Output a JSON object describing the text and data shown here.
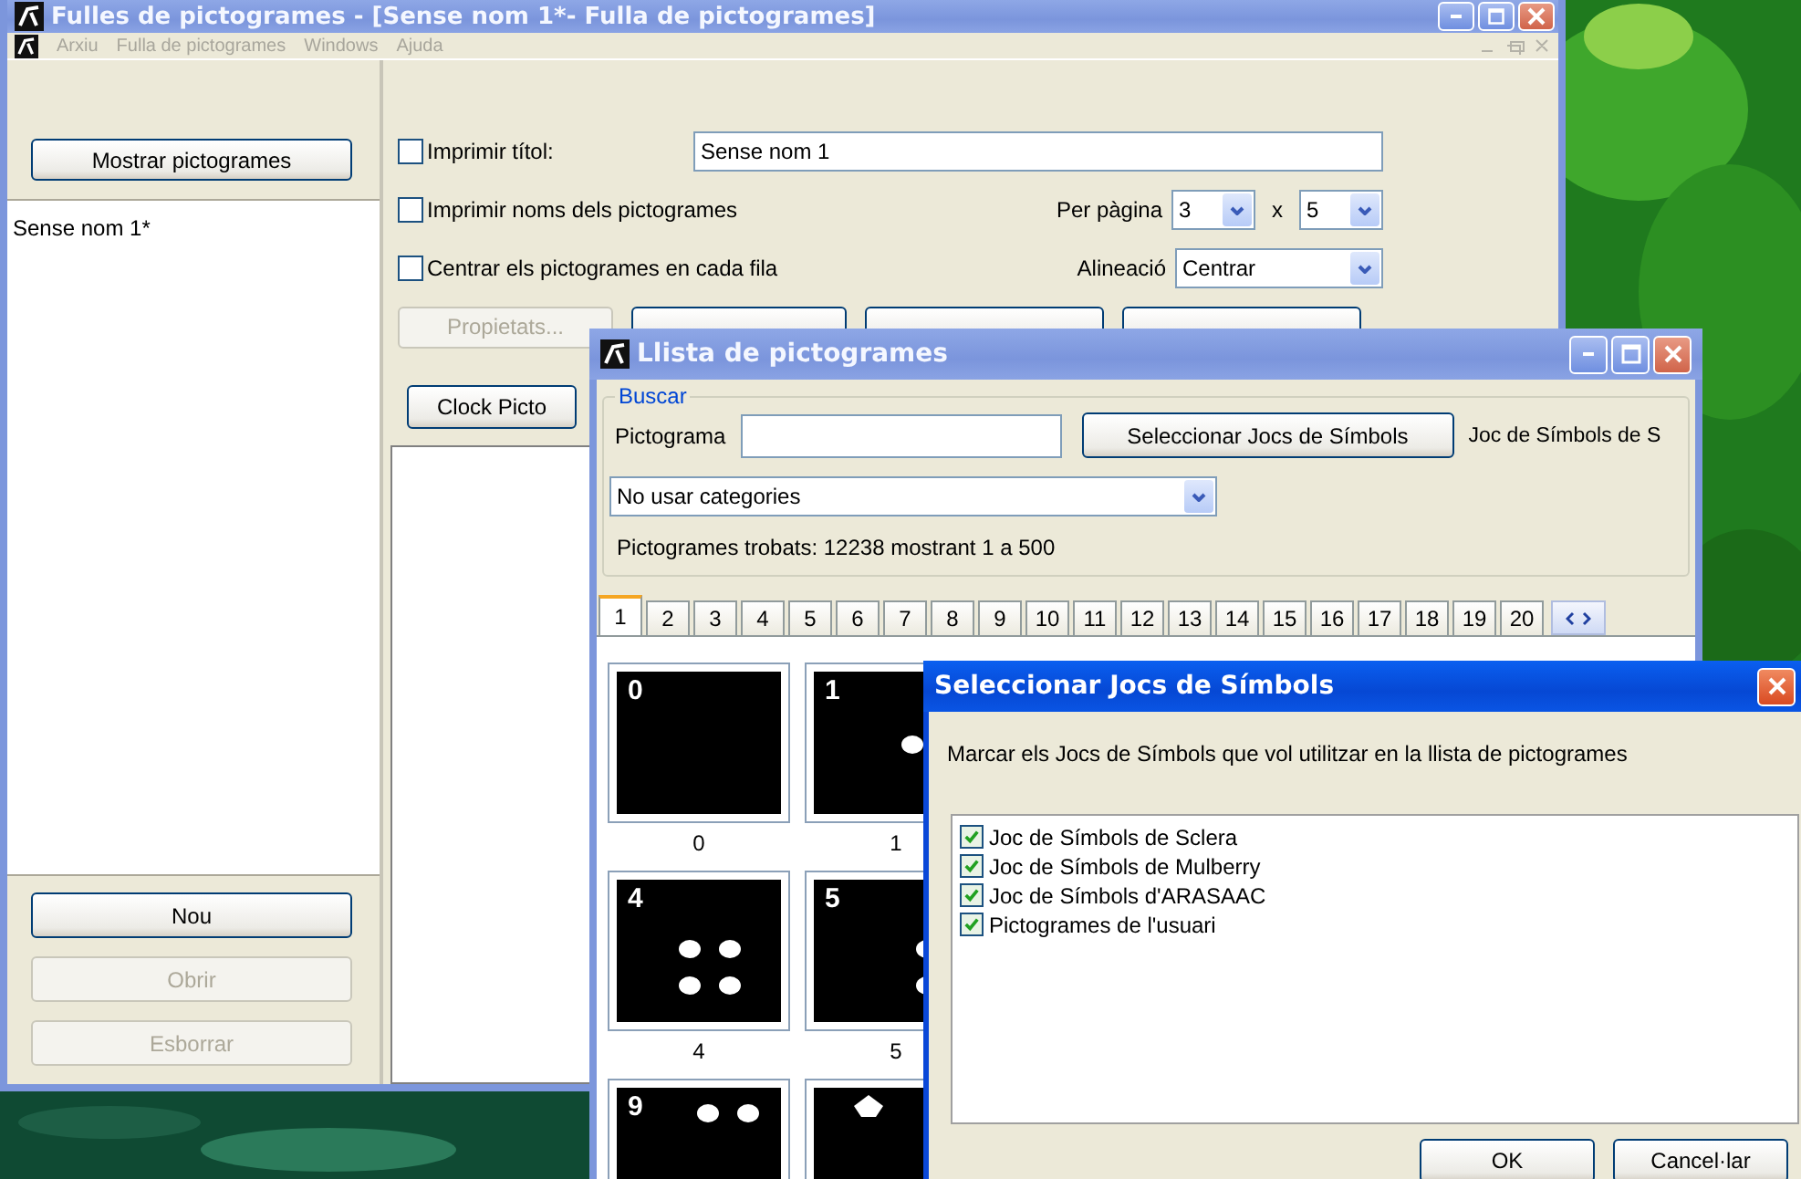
{
  "main_window": {
    "title": "Fulles de pictogrames - [Sense nom 1*- Fulla de pictogrames]",
    "menu": [
      {
        "label": "Arxiu",
        "disabled": true
      },
      {
        "label": "Fulla de pictogrames",
        "disabled": true
      },
      {
        "label": "Windows",
        "disabled": true
      },
      {
        "label": "Ajuda",
        "disabled": true
      }
    ],
    "show_button": "Mostrar pictogrames",
    "sheets": [
      {
        "label": "Sense nom 1*",
        "selected": false
      }
    ],
    "sheet_buttons": [
      {
        "label": "Nou",
        "disabled": false
      },
      {
        "label": "Obrir",
        "disabled": true
      },
      {
        "label": "Esborrar",
        "disabled": true
      }
    ],
    "print_title": {
      "label": "Imprimir títol:",
      "checked": false
    },
    "title_value": "Sense nom 1",
    "print_names": {
      "label": "Imprimir noms dels pictogrames",
      "checked": false
    },
    "center_rows": {
      "label": "Centrar els pictogrames en cada fila",
      "checked": false
    },
    "per_page_label": "Per pàgina",
    "rows_value": "3",
    "times": "x",
    "cols_value": "5",
    "alignment_label": "Alineació",
    "alignment_value": "Centrar",
    "properties_button": {
      "label": "Propietats...",
      "disabled": true
    },
    "clock_button": {
      "label": "Clock Picto",
      "disabled": false
    }
  },
  "list_window": {
    "title": "Llista de pictogrames",
    "group_title": "Buscar",
    "search_label": "Pictograma",
    "select_button": "Seleccionar Jocs de Símbols",
    "symbol_set_text": "Joc de Símbols de S",
    "category": "No usar categories",
    "found_text": "Pictogrames trobats: 12238 mostrant 1 a 500",
    "tabs": [
      {
        "label": "1",
        "selected": true
      },
      {
        "label": "2",
        "selected": false
      },
      {
        "label": "3",
        "selected": false
      },
      {
        "label": "4",
        "selected": false
      },
      {
        "label": "5",
        "selected": false
      },
      {
        "label": "6",
        "selected": false
      },
      {
        "label": "7",
        "selected": false
      },
      {
        "label": "8",
        "selected": false
      },
      {
        "label": "9",
        "selected": false
      },
      {
        "label": "10",
        "selected": false
      },
      {
        "label": "11",
        "selected": false
      },
      {
        "label": "12",
        "selected": false
      },
      {
        "label": "13",
        "selected": false
      },
      {
        "label": "14",
        "selected": false
      },
      {
        "label": "15",
        "selected": false
      },
      {
        "label": "16",
        "selected": false
      },
      {
        "label": "17",
        "selected": false
      },
      {
        "label": "18",
        "selected": false
      },
      {
        "label": "19",
        "selected": false
      },
      {
        "label": "20",
        "selected": false
      }
    ],
    "pictograms": [
      {
        "kind": "number",
        "number": "0",
        "caption": "0"
      },
      {
        "kind": "number",
        "number": "1",
        "caption": "1"
      },
      {
        "kind": "number",
        "number": "4",
        "caption": "4"
      },
      {
        "kind": "number",
        "number": "5",
        "caption": "5"
      },
      {
        "kind": "number",
        "number": "9"
      },
      {
        "kind": "blank"
      }
    ]
  },
  "dialog": {
    "title": "Seleccionar Jocs de Símbols",
    "instruction": "Marcar els Jocs de Símbols que vol utilitzar en la llista de pictogrames",
    "sets": [
      {
        "label": "Joc de Símbols de Sclera",
        "checked": true
      },
      {
        "label": "Joc de Símbols de Mulberry",
        "checked": true
      },
      {
        "label": "Joc de Símbols d'ARASAAC",
        "checked": true
      },
      {
        "label": "Pictogrames de l'usuari",
        "checked": true
      }
    ],
    "buttons": [
      "OK",
      "Cancel·lar"
    ]
  }
}
